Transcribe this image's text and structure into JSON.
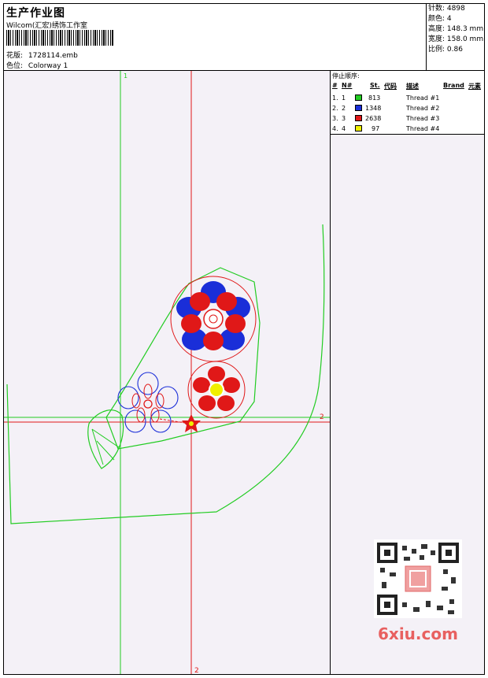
{
  "header": {
    "title": "生产作业图",
    "studio": "Wilcom(汇宏)绣饰工作室",
    "design_file_label": "花版:",
    "design_file": "1728114.emb",
    "colorway_label": "色位:",
    "colorway": "Colorway 1"
  },
  "stats": {
    "stitches_label": "针数:",
    "stitches": "4898",
    "colors_label": "颜色:",
    "colors": "4",
    "height_label": "高度:",
    "height": "148.3 mm",
    "width_label": "宽度:",
    "width": "158.0 mm",
    "scale_label": "比例:",
    "scale": "0.86"
  },
  "stop_sequence": {
    "title": "停止顺序:",
    "columns": [
      "#",
      "N#",
      "St.",
      "代码",
      "描述",
      "Brand",
      "元素"
    ],
    "rows": [
      {
        "num": "1.",
        "n": "1",
        "color": "#22cc22",
        "st": "813",
        "desc": "Thread #1"
      },
      {
        "num": "2.",
        "n": "2",
        "color": "#1a2ed8",
        "st": "1348",
        "desc": "Thread #2"
      },
      {
        "num": "3.",
        "n": "3",
        "color": "#e01818",
        "st": "2638",
        "desc": "Thread #3"
      },
      {
        "num": "4.",
        "n": "4",
        "color": "#f0f000",
        "st": "97",
        "desc": "Thread #4"
      }
    ]
  },
  "axes": {
    "v1": "1",
    "h2": "2",
    "v2": "2"
  },
  "watermark": "6xiu.com",
  "colors": {
    "guide_green": "#22cc22",
    "guide_red": "#e01818",
    "blue": "#1a2ed8",
    "yellow": "#f0f000"
  }
}
